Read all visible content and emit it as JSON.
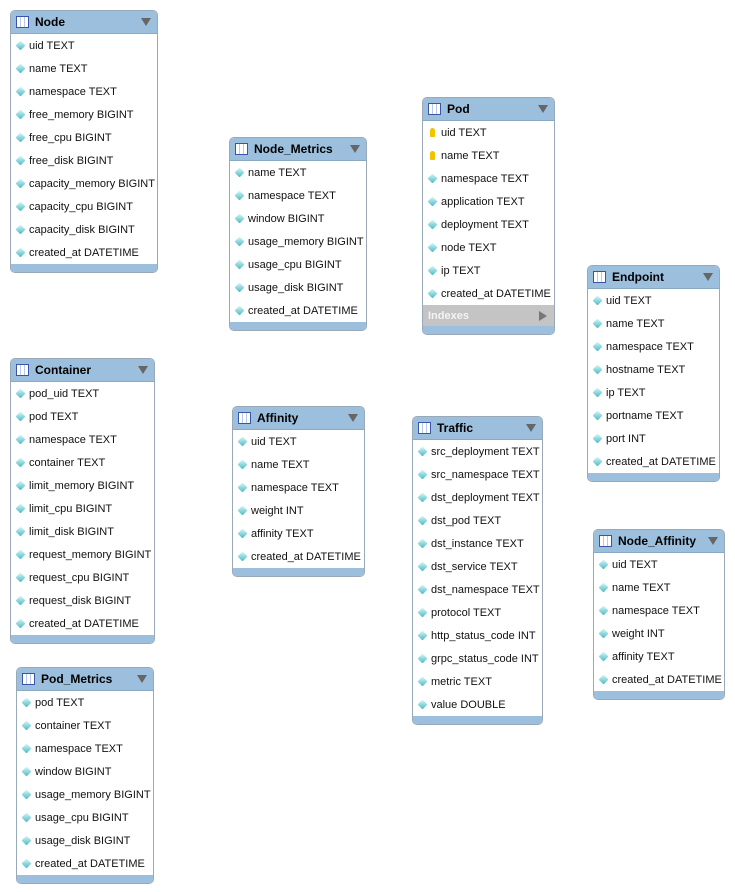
{
  "tables": [
    {
      "name": "Node",
      "columns": [
        {
          "label": "uid TEXT"
        },
        {
          "label": "name TEXT"
        },
        {
          "label": "namespace TEXT"
        },
        {
          "label": "free_memory BIGINT"
        },
        {
          "label": "free_cpu BIGINT"
        },
        {
          "label": "free_disk BIGINT"
        },
        {
          "label": "capacity_memory BIGINT"
        },
        {
          "label": "capacity_cpu BIGINT"
        },
        {
          "label": "capacity_disk BIGINT"
        },
        {
          "label": "created_at DATETIME"
        }
      ]
    },
    {
      "name": "Node_Metrics",
      "columns": [
        {
          "label": "name TEXT"
        },
        {
          "label": "namespace TEXT"
        },
        {
          "label": "window BIGINT"
        },
        {
          "label": "usage_memory BIGINT"
        },
        {
          "label": "usage_cpu BIGINT"
        },
        {
          "label": "usage_disk BIGINT"
        },
        {
          "label": "created_at DATETIME"
        }
      ]
    },
    {
      "name": "Pod",
      "columns": [
        {
          "label": "uid TEXT",
          "key": true
        },
        {
          "label": "name TEXT",
          "key": true
        },
        {
          "label": "namespace TEXT"
        },
        {
          "label": "application TEXT"
        },
        {
          "label": "deployment TEXT"
        },
        {
          "label": "node TEXT"
        },
        {
          "label": "ip TEXT"
        },
        {
          "label": "created_at DATETIME"
        }
      ],
      "indexes": "Indexes"
    },
    {
      "name": "Endpoint",
      "columns": [
        {
          "label": "uid TEXT"
        },
        {
          "label": "name TEXT"
        },
        {
          "label": "namespace TEXT"
        },
        {
          "label": "hostname TEXT"
        },
        {
          "label": "ip TEXT"
        },
        {
          "label": "portname TEXT"
        },
        {
          "label": "port INT"
        },
        {
          "label": "created_at DATETIME"
        }
      ]
    },
    {
      "name": "Container",
      "columns": [
        {
          "label": "pod_uid TEXT"
        },
        {
          "label": "pod TEXT"
        },
        {
          "label": "namespace TEXT"
        },
        {
          "label": "container TEXT"
        },
        {
          "label": "limit_memory BIGINT"
        },
        {
          "label": "limit_cpu BIGINT"
        },
        {
          "label": "limit_disk BIGINT"
        },
        {
          "label": "request_memory BIGINT"
        },
        {
          "label": "request_cpu BIGINT"
        },
        {
          "label": "request_disk BIGINT"
        },
        {
          "label": "created_at DATETIME"
        }
      ]
    },
    {
      "name": "Affinity",
      "columns": [
        {
          "label": "uid TEXT"
        },
        {
          "label": "name TEXT"
        },
        {
          "label": "namespace TEXT"
        },
        {
          "label": "weight INT"
        },
        {
          "label": "affinity TEXT"
        },
        {
          "label": "created_at DATETIME"
        }
      ]
    },
    {
      "name": "Traffic",
      "columns": [
        {
          "label": "src_deployment TEXT"
        },
        {
          "label": "src_namespace TEXT"
        },
        {
          "label": "dst_deployment TEXT"
        },
        {
          "label": "dst_pod TEXT"
        },
        {
          "label": "dst_instance TEXT"
        },
        {
          "label": "dst_service TEXT"
        },
        {
          "label": "dst_namespace TEXT"
        },
        {
          "label": "protocol TEXT"
        },
        {
          "label": "http_status_code INT"
        },
        {
          "label": "grpc_status_code INT"
        },
        {
          "label": "metric TEXT"
        },
        {
          "label": "value DOUBLE"
        }
      ]
    },
    {
      "name": "Node_Affinity",
      "columns": [
        {
          "label": "uid TEXT"
        },
        {
          "label": "name TEXT"
        },
        {
          "label": "namespace TEXT"
        },
        {
          "label": "weight INT"
        },
        {
          "label": "affinity TEXT"
        },
        {
          "label": "created_at DATETIME"
        }
      ]
    },
    {
      "name": "Pod_Metrics",
      "columns": [
        {
          "label": "pod TEXT"
        },
        {
          "label": "container TEXT"
        },
        {
          "label": "namespace TEXT"
        },
        {
          "label": "window BIGINT"
        },
        {
          "label": "usage_memory BIGINT"
        },
        {
          "label": "usage_cpu BIGINT"
        },
        {
          "label": "usage_disk BIGINT"
        },
        {
          "label": "created_at DATETIME"
        }
      ]
    }
  ]
}
